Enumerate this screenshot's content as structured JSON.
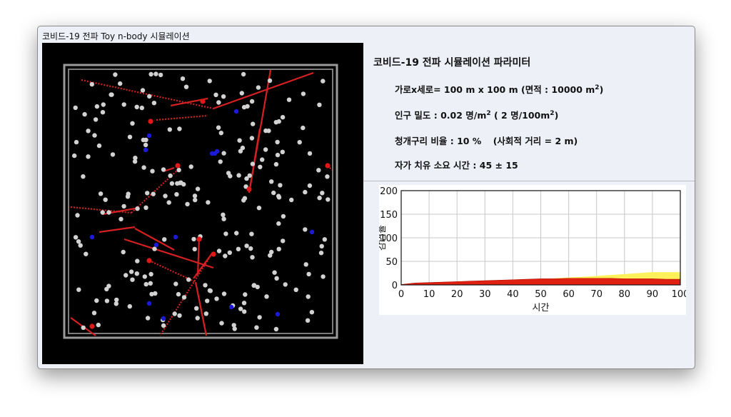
{
  "window": {
    "title": "코비드-19 전파 Toy n-body 시뮬레이션"
  },
  "params": {
    "title": "코비드-19 전파 시뮬레이션 파라미터",
    "size": {
      "label": "가로x세로=",
      "value": "100 m x  100 m",
      "area_label": "(면적 :",
      "area_value": "10000 m",
      "area_exp": "2",
      "close": ")"
    },
    "density": {
      "label": "인구 밀도 :",
      "value": "0.02 명/m",
      "exp": "2",
      "alt": "( 2 명/100m",
      "alt_exp": "2",
      "alt_close": ")"
    },
    "frog": {
      "label": "청개구리 비율 :",
      "value": "10 %",
      "distance": "(사회적 거리 =  2 m)"
    },
    "heal": {
      "label": "자가 치유 소요 시간 :",
      "value": "45 ± 15"
    }
  },
  "colors": {
    "healthy": "#d2d2d2",
    "infected": "#e01818",
    "frog": "#1a1ad8",
    "recovered_area": "#fff15a",
    "infected_area": "#e02010",
    "box": "#9a9a9a"
  },
  "chart_data": {
    "type": "area",
    "xlabel": "시간",
    "ylabel": "감염율",
    "xlim": [
      0,
      100
    ],
    "ylim": [
      0,
      200
    ],
    "xticks": [
      0,
      10,
      20,
      30,
      40,
      50,
      60,
      70,
      80,
      90,
      100
    ],
    "yticks": [
      0,
      50,
      100,
      150,
      200
    ],
    "grid": true,
    "x": [
      0,
      5,
      10,
      15,
      20,
      25,
      30,
      35,
      40,
      45,
      50,
      55,
      60,
      65,
      70,
      75,
      80,
      85,
      90,
      95,
      100
    ],
    "series": [
      {
        "values": [
          1,
          4,
          5,
          6,
          7,
          8,
          9,
          10,
          11,
          12,
          13,
          13,
          14,
          14,
          14,
          14,
          13,
          13,
          13,
          12,
          12
        ]
      },
      {
        "values": [
          0,
          0,
          0,
          0,
          0,
          0,
          0,
          0,
          0,
          0,
          0,
          1,
          2,
          3,
          5,
          7,
          10,
          12,
          14,
          15,
          15
        ]
      }
    ]
  }
}
